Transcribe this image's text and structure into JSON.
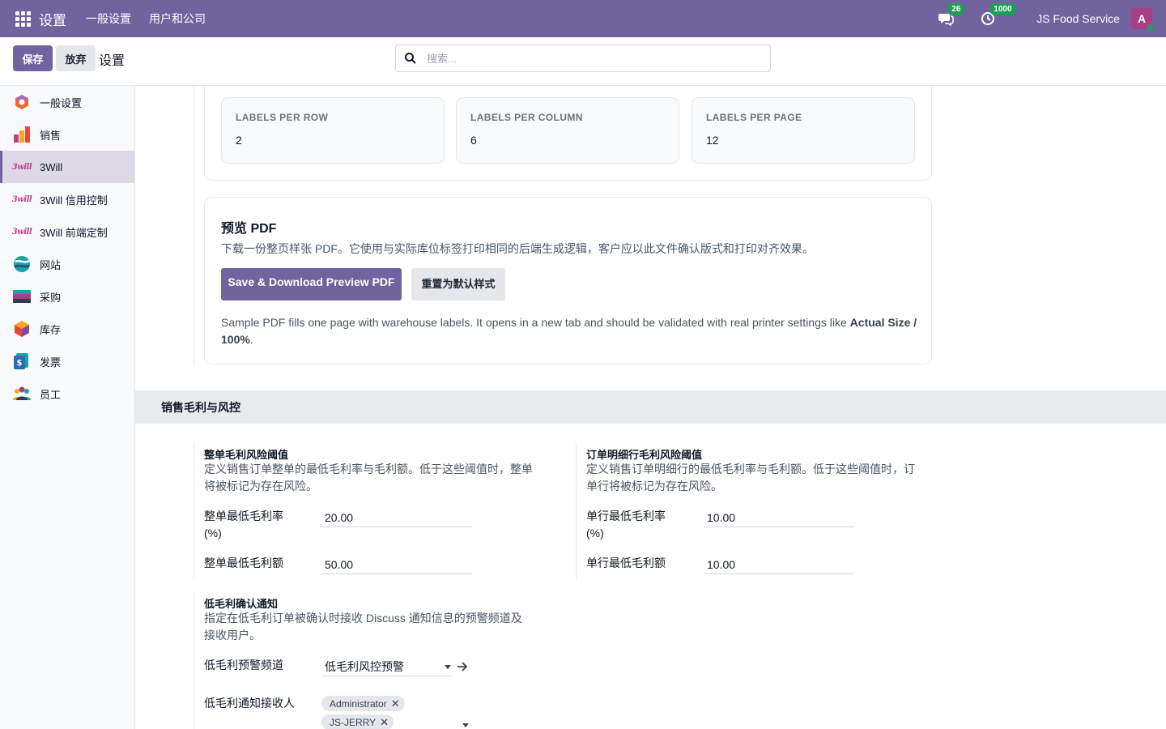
{
  "navbar": {
    "brand": "设置",
    "menus": [
      "一般设置",
      "用户和公司"
    ],
    "messages_count": "26",
    "activities_count": "1000",
    "company": "JS Food Service",
    "avatar_letter": "A",
    "color": "#71639e"
  },
  "control": {
    "save_label": "保存",
    "discard_label": "放弃",
    "breadcrumb": "设置",
    "search_placeholder": "搜索..."
  },
  "sidebar": {
    "items": [
      {
        "label": "一般设置",
        "icon": "general-settings-icon"
      },
      {
        "label": "销售",
        "icon": "sales-icon"
      },
      {
        "label": "3Will",
        "icon": "3will-logo-icon",
        "active": true
      },
      {
        "label": "3Will 信用控制",
        "icon": "3will-logo-icon"
      },
      {
        "label": "3Will 前端定制",
        "icon": "3will-logo-icon"
      },
      {
        "label": "网站",
        "icon": "website-icon"
      },
      {
        "label": "采购",
        "icon": "purchase-icon"
      },
      {
        "label": "库存",
        "icon": "inventory-icon"
      },
      {
        "label": "发票",
        "icon": "invoicing-icon"
      },
      {
        "label": "员工",
        "icon": "employees-icon"
      }
    ],
    "logo_text": "3will"
  },
  "labels_card": {
    "metrics": [
      {
        "label": "LABELS PER ROW",
        "value": "2"
      },
      {
        "label": "LABELS PER COLUMN",
        "value": "6"
      },
      {
        "label": "LABELS PER PAGE",
        "value": "12"
      }
    ]
  },
  "preview_card": {
    "title": "预览 PDF",
    "description": "下载一份整页样张 PDF。它使用与实际库位标签打印相同的后端生成逻辑，客户应以此文件确认版式和打印对齐效果。",
    "primary_button": "Save & Download Preview PDF",
    "secondary_button": "重置为默认样式",
    "note_prefix": "Sample PDF fills one page with warehouse labels. It opens in a new tab and should be validated with real printer settings like ",
    "note_bold": "Actual Size / 100%",
    "note_suffix": "."
  },
  "margin_section": {
    "title": "销售毛利与风控",
    "order_threshold": {
      "title": "整单毛利风险阈值",
      "desc_line1": "定义销售订单整单的最低毛利率与毛利额。低于这些阈值时，整单",
      "desc_line2": "将被标记为存在风险。",
      "rate_label_line1": "整单最低毛利率",
      "rate_label_line2": "(%)",
      "rate_value": "20.00",
      "amount_label": "整单最低毛利额",
      "amount_value": "50.00"
    },
    "line_threshold": {
      "title": "订单明细行毛利风险阈值",
      "desc_line1": "定义销售订单明细行的最低毛利率与毛利额。低于这些阈值时，订",
      "desc_line2": "单行将被标记为存在风险。",
      "rate_label_line1": "单行最低毛利率",
      "rate_label_line2": "(%)",
      "rate_value": "10.00",
      "amount_label": "单行最低毛利额",
      "amount_value": "10.00"
    },
    "notification": {
      "title": "低毛利确认通知",
      "desc_line1": "指定在低毛利订单被确认时接收 Discuss 通知信息的预警频道及",
      "desc_line2": "接收用户。",
      "channel_label": "低毛利预警频道",
      "channel_value": "低毛利风控预警",
      "recipients_label": "低毛利通知接收人",
      "recipients": [
        "Administrator",
        "JS-JERRY"
      ]
    }
  }
}
